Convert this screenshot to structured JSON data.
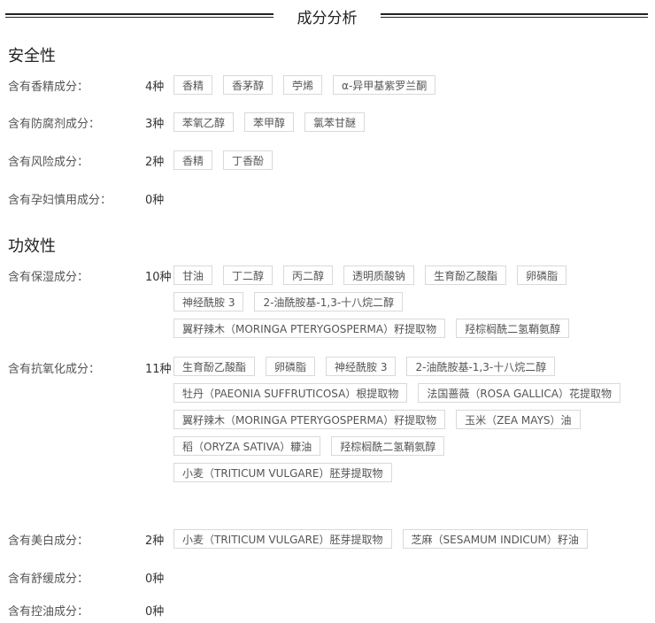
{
  "header": {
    "title": "成分分析"
  },
  "safety": {
    "title": "安全性",
    "rows": [
      {
        "label": "含有香精成分：",
        "count": "4种",
        "tags": [
          "香精",
          "香茅醇",
          "苧烯",
          "α-异甲基紫罗兰酮"
        ]
      },
      {
        "label": "含有防腐剂成分：",
        "count": "3种",
        "tags": [
          "苯氧乙醇",
          "苯甲醇",
          "氯苯甘醚"
        ]
      },
      {
        "label": "含有风险成分：",
        "count": "2种",
        "tags": [
          "香精",
          "丁香酚"
        ]
      },
      {
        "label": "含有孕妇慎用成分：",
        "count": "0种",
        "tags": []
      }
    ]
  },
  "efficacy": {
    "title": "功效性",
    "rows": [
      {
        "label": "含有保湿成分：",
        "count": "10种",
        "tags": [
          "甘油",
          "丁二醇",
          "丙二醇",
          "透明质酸钠",
          "生育酚乙酸酯",
          "卵磷脂",
          "神经酰胺 3",
          "2-油酰胺基-1,3-十八烷二醇",
          "翼籽辣木（MORINGA PTERYGOSPERMA）籽提取物",
          "羟棕榈酰二氢鞘氨醇"
        ]
      },
      {
        "label": "含有抗氧化成分：",
        "count": "11种",
        "tags": [
          "生育酚乙酸酯",
          "卵磷脂",
          "神经酰胺 3",
          "2-油酰胺基-1,3-十八烷二醇",
          "牡丹（PAEONIA SUFFRUTICOSA）根提取物",
          "法国蔷薇（ROSA GALLICA）花提取物",
          "翼籽辣木（MORINGA PTERYGOSPERMA）籽提取物",
          "玉米（ZEA MAYS）油",
          "稻（ORYZA SATIVA）糠油",
          "羟棕榈酰二氢鞘氨醇",
          "小麦（TRITICUM VULGARE）胚芽提取物"
        ]
      },
      {
        "label": "含有美白成分：",
        "count": "2种",
        "tags": [
          "小麦（TRITICUM VULGARE）胚芽提取物",
          "芝麻（SESAMUM INDICUM）籽油"
        ]
      },
      {
        "label": "含有舒缓成分：",
        "count": "0种",
        "tags": []
      },
      {
        "label": "含有控油成分：",
        "count": "0种",
        "tags": []
      }
    ]
  }
}
